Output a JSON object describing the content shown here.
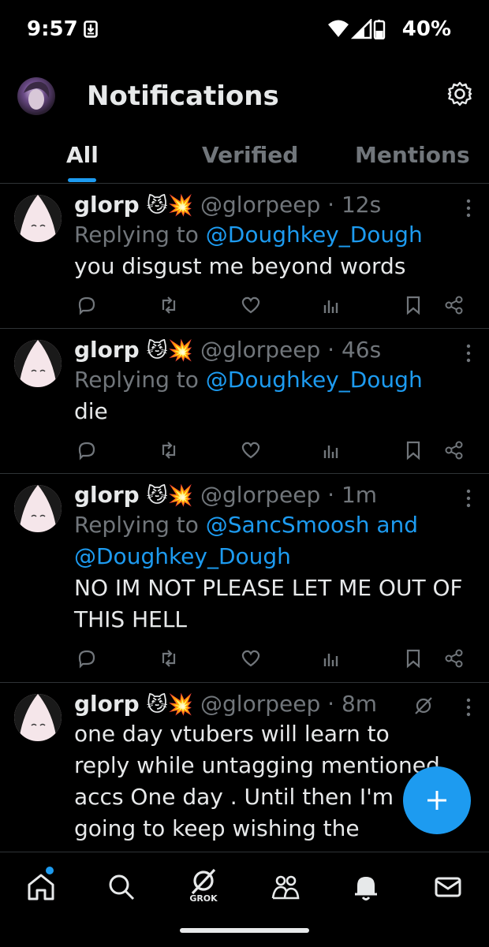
{
  "status": {
    "time": "9:57",
    "battery": "40%"
  },
  "header": {
    "title": "Notifications"
  },
  "tabs": [
    {
      "label": "All"
    },
    {
      "label": "Verified"
    },
    {
      "label": "Mentions"
    }
  ],
  "posts": [
    {
      "name": "glorp",
      "emoji": "😼💥",
      "handle": "@glorpeep",
      "time": "12s",
      "reply_prefix": "Replying to",
      "reply_mentions": "@Doughkey_Dough",
      "text": "you disgust me beyond words"
    },
    {
      "name": "glorp",
      "emoji": "😼💥",
      "handle": "@glorpeep",
      "time": "46s",
      "reply_prefix": "Replying to",
      "reply_mentions": "@Doughkey_Dough",
      "text": "die"
    },
    {
      "name": "glorp",
      "emoji": "😼💥",
      "handle": "@glorpeep",
      "time": "1m",
      "reply_prefix": "Replying to",
      "reply_mentions": "@SancSmoosh and",
      "reply_mentions2": "@Doughkey_Dough",
      "text": "NO IM NOT PLEASE LET ME OUT OF THIS HELL"
    },
    {
      "name": "glorp",
      "emoji": "😼💥",
      "handle": "@glorpeep",
      "time": "8m",
      "text": "one day vtubers will learn to reply while untagging mentioned accs One day . Until then I'm going to keep wishing the WORST on you fuck"
    }
  ],
  "nav": {
    "grok_label": "GROK"
  },
  "colors": {
    "accent": "#1d9bf0",
    "muted": "#71767b",
    "text": "#e7e9ea",
    "divider": "#2f3336"
  },
  "icons": [
    "download-status-icon",
    "wifi-icon",
    "signal-icon",
    "battery-icon",
    "gear-icon",
    "reply-icon",
    "repost-icon",
    "like-icon",
    "views-icon",
    "bookmark-icon",
    "share-icon",
    "more-icon",
    "grok-icon",
    "home-icon",
    "search-icon",
    "communities-icon",
    "bell-icon",
    "mail-icon",
    "plus-icon"
  ]
}
